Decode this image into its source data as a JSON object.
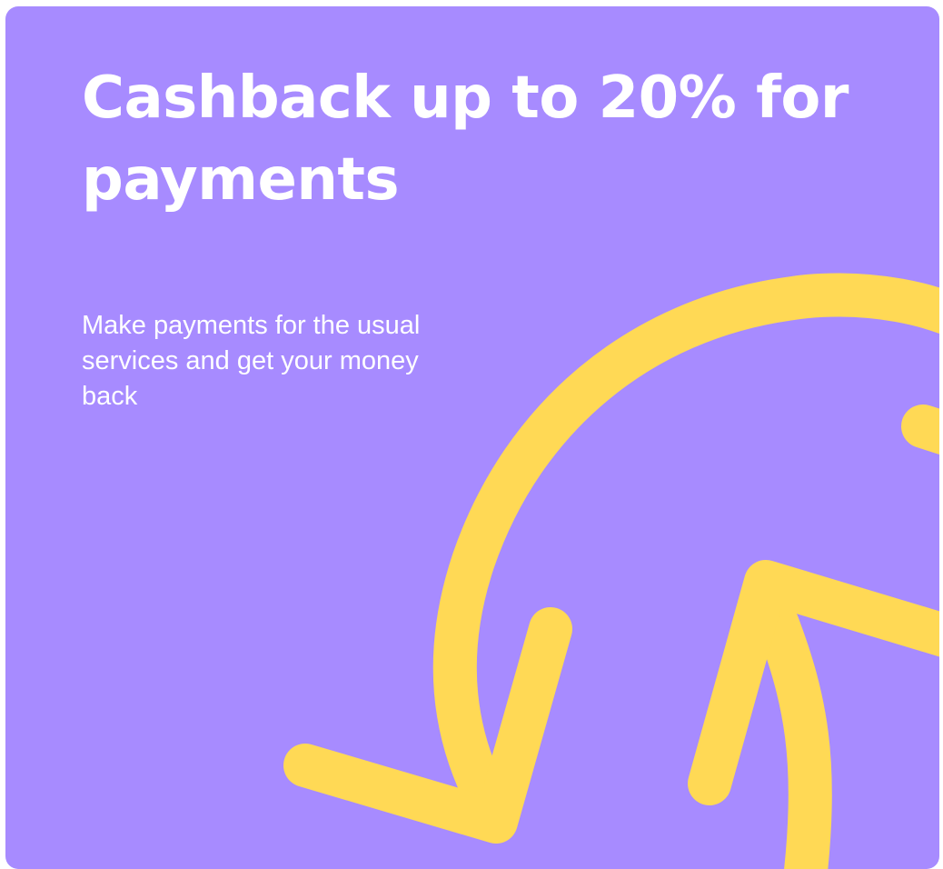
{
  "card": {
    "title": "Cashback up to 20% for payments",
    "description": "Make payments for the usual services and get your money back",
    "background_color": "#a78bff",
    "accent_color": "#ffd955",
    "illustration_icon": "circular-arrows-icon"
  }
}
